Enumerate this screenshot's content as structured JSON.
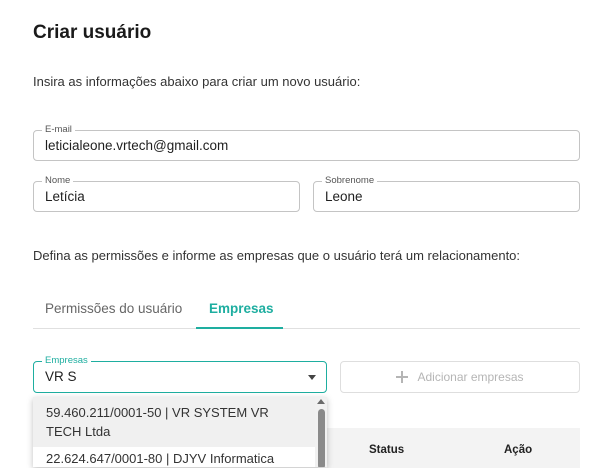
{
  "page": {
    "title": "Criar usuário",
    "intro": "Insira as informações abaixo para criar um novo usuário:"
  },
  "form": {
    "email": {
      "label": "E-mail",
      "value": "leticialeone.vrtech@gmail.com"
    },
    "nome": {
      "label": "Nome",
      "value": "Letícia"
    },
    "sobrenome": {
      "label": "Sobrenome",
      "value": "Leone"
    }
  },
  "permissions_text": "Defina as permissões e informe as empresas que o usuário terá um relacionamento:",
  "tabs": [
    {
      "label": "Permissões do usuário",
      "active": false
    },
    {
      "label": "Empresas",
      "active": true
    }
  ],
  "empresas": {
    "label": "Empresas",
    "value": "VR S",
    "add_button": "Adicionar empresas",
    "options": [
      "59.460.211/0001-50 | VR SYSTEM VR TECH Ltda",
      "22.624.647/0001-80 | DJYV Informatica"
    ]
  },
  "table": {
    "columns": [
      "Status",
      "Ação"
    ]
  },
  "colors": {
    "accent": "#1eaea0",
    "border": "#c4c4c4",
    "disabled": "#b5b5b5"
  }
}
